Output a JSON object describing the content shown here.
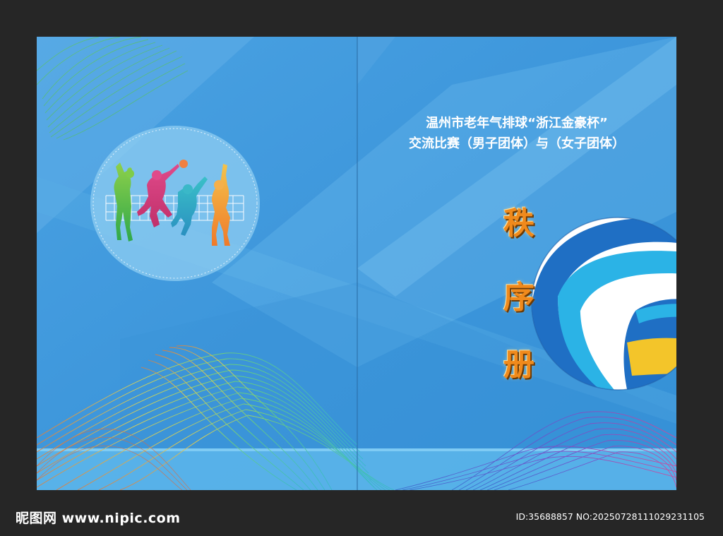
{
  "cover": {
    "title_line1": "温州市老年气排球“浙江金豪杯”",
    "title_line2": "交流比赛（男子团体）与（女子团体）",
    "heading_chars": [
      "秩",
      "序",
      "册"
    ]
  },
  "emblem": {
    "icon": "volleyball-players-silhouette-icon"
  },
  "watermark": {
    "site": "昵图网 www.nipic.com",
    "id_text": "ID:35688857 NO:20250728111029231105"
  },
  "colors": {
    "frame": "#262626",
    "cover_blue": "#3c97dc",
    "light_blue": "#6cc3f0",
    "ball_blue": "#1f6fc4",
    "ball_cyan": "#2bb3e6",
    "ball_yellow": "#f3c52a",
    "heading_orange": "#f08a1c"
  }
}
